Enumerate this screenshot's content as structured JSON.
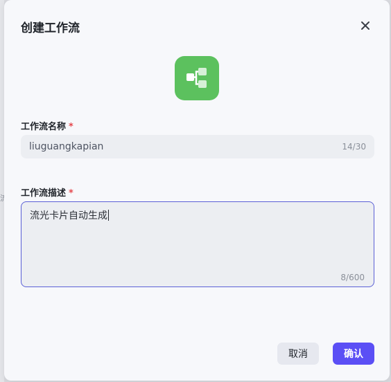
{
  "backdrop": {
    "text": "流"
  },
  "dialog": {
    "title": "创建工作流",
    "logo_icon": "workflow-icon",
    "accent_color": "#5cc15e"
  },
  "name_field": {
    "label": "工作流名称",
    "required_mark": "*",
    "value": "liuguangkapian",
    "counter": "14/30"
  },
  "desc_field": {
    "label": "工作流描述",
    "required_mark": "*",
    "value": "流光卡片自动生成",
    "counter": "8/600"
  },
  "buttons": {
    "cancel": "取消",
    "confirm": "确认",
    "confirm_color": "#5b4ff5"
  }
}
